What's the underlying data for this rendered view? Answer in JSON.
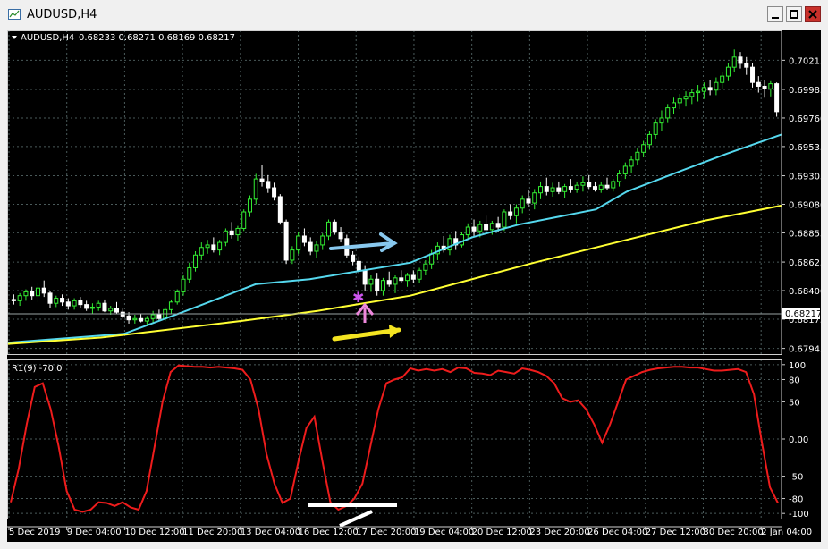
{
  "window": {
    "title": "AUDUSD,H4",
    "buttons": [
      "minimize",
      "maximize",
      "close"
    ]
  },
  "chart_data": [
    {
      "type": "candlestick",
      "header_symbol": "AUDUSD,H4",
      "header_ohlc": "0.68233 0.68271 0.68169 0.68217",
      "y_ticks": [
        "0.70215",
        "0.69985",
        "0.69760",
        "0.69535",
        "0.69305",
        "0.69080",
        "0.68855",
        "0.68625",
        "0.68400",
        "0.68175",
        "0.67945"
      ],
      "current_price": "0.68217",
      "ylim": [
        0.679,
        0.7045
      ],
      "colors": {
        "bull": "#33ee33",
        "bear": "#ffffff",
        "ma_fast": "#55d8ee",
        "ma_slow": "#ffff33",
        "background": "#000000",
        "grid": "#4a5a5a"
      },
      "candles": [
        [
          0.6833,
          0.6837,
          0.6829,
          0.6832
        ],
        [
          0.6832,
          0.6838,
          0.6828,
          0.6836
        ],
        [
          0.6836,
          0.6841,
          0.6832,
          0.6839
        ],
        [
          0.6839,
          0.6843,
          0.6833,
          0.6836
        ],
        [
          0.6836,
          0.6846,
          0.6831,
          0.6842
        ],
        [
          0.6842,
          0.6848,
          0.6835,
          0.6838
        ],
        [
          0.6838,
          0.684,
          0.6826,
          0.683
        ],
        [
          0.683,
          0.6836,
          0.6827,
          0.6834
        ],
        [
          0.6834,
          0.6837,
          0.6828,
          0.6831
        ],
        [
          0.6831,
          0.6834,
          0.6825,
          0.6828
        ],
        [
          0.6828,
          0.6834,
          0.6825,
          0.6832
        ],
        [
          0.6832,
          0.6835,
          0.6826,
          0.6829
        ],
        [
          0.6829,
          0.6832,
          0.6824,
          0.6826
        ],
        [
          0.6826,
          0.683,
          0.6822,
          0.6827
        ],
        [
          0.6827,
          0.6832,
          0.6824,
          0.683
        ],
        [
          0.683,
          0.6833,
          0.6823,
          0.6824
        ],
        [
          0.6824,
          0.6828,
          0.6821,
          0.6826
        ],
        [
          0.6826,
          0.6831,
          0.6822,
          0.6823
        ],
        [
          0.6823,
          0.6826,
          0.6818,
          0.682
        ],
        [
          0.682,
          0.6823,
          0.6814,
          0.6817
        ],
        [
          0.6817,
          0.6821,
          0.6814,
          0.6818
        ],
        [
          0.6818,
          0.6822,
          0.6815,
          0.6816
        ],
        [
          0.6816,
          0.682,
          0.6813,
          0.6818
        ],
        [
          0.6818,
          0.6824,
          0.6815,
          0.6821
        ],
        [
          0.6821,
          0.6825,
          0.6816,
          0.6818
        ],
        [
          0.6818,
          0.6827,
          0.6816,
          0.6825
        ],
        [
          0.6825,
          0.6833,
          0.6822,
          0.6831
        ],
        [
          0.6831,
          0.6841,
          0.6829,
          0.6839
        ],
        [
          0.6839,
          0.6852,
          0.6836,
          0.6849
        ],
        [
          0.6849,
          0.6862,
          0.6846,
          0.6858
        ],
        [
          0.6858,
          0.6871,
          0.6855,
          0.6868
        ],
        [
          0.6868,
          0.6878,
          0.6864,
          0.6874
        ],
        [
          0.6874,
          0.688,
          0.6869,
          0.6876
        ],
        [
          0.6876,
          0.6882,
          0.687,
          0.6872
        ],
        [
          0.6872,
          0.688,
          0.6868,
          0.6878
        ],
        [
          0.6878,
          0.6889,
          0.6875,
          0.6887
        ],
        [
          0.6887,
          0.6894,
          0.6881,
          0.6884
        ],
        [
          0.6884,
          0.6891,
          0.6879,
          0.6889
        ],
        [
          0.6889,
          0.6904,
          0.6887,
          0.6902
        ],
        [
          0.6902,
          0.6915,
          0.6898,
          0.6912
        ],
        [
          0.6912,
          0.6932,
          0.6908,
          0.6928
        ],
        [
          0.6928,
          0.6939,
          0.6922,
          0.6926
        ],
        [
          0.6926,
          0.6931,
          0.6917,
          0.6921
        ],
        [
          0.6921,
          0.6925,
          0.6911,
          0.6914
        ],
        [
          0.6914,
          0.6916,
          0.6892,
          0.6894
        ],
        [
          0.6894,
          0.6896,
          0.6861,
          0.6864
        ],
        [
          0.6864,
          0.6875,
          0.6861,
          0.6872
        ],
        [
          0.6872,
          0.6886,
          0.6869,
          0.6883
        ],
        [
          0.6883,
          0.6889,
          0.6875,
          0.6878
        ],
        [
          0.6878,
          0.6882,
          0.6868,
          0.6871
        ],
        [
          0.6871,
          0.6879,
          0.6866,
          0.6876
        ],
        [
          0.6876,
          0.6885,
          0.6872,
          0.6883
        ],
        [
          0.6883,
          0.6896,
          0.688,
          0.6894
        ],
        [
          0.6894,
          0.6896,
          0.6884,
          0.6886
        ],
        [
          0.6886,
          0.689,
          0.6878,
          0.6881
        ],
        [
          0.6881,
          0.6884,
          0.6866,
          0.6868
        ],
        [
          0.6868,
          0.6871,
          0.686,
          0.6863
        ],
        [
          0.6863,
          0.6867,
          0.6853,
          0.6856
        ],
        [
          0.6856,
          0.686,
          0.684,
          0.6845
        ],
        [
          0.6845,
          0.6852,
          0.6839,
          0.6849
        ],
        [
          0.6849,
          0.6854,
          0.6836,
          0.684
        ],
        [
          0.684,
          0.685,
          0.6836,
          0.6848
        ],
        [
          0.6848,
          0.6855,
          0.6843,
          0.6845
        ],
        [
          0.6845,
          0.6852,
          0.6838,
          0.685
        ],
        [
          0.685,
          0.6856,
          0.6846,
          0.6848
        ],
        [
          0.6848,
          0.6854,
          0.6843,
          0.6852
        ],
        [
          0.6852,
          0.6856,
          0.6846,
          0.6849
        ],
        [
          0.6849,
          0.6858,
          0.6846,
          0.6856
        ],
        [
          0.6856,
          0.6864,
          0.6852,
          0.6861
        ],
        [
          0.6861,
          0.6872,
          0.6857,
          0.6869
        ],
        [
          0.6869,
          0.6878,
          0.6864,
          0.6875
        ],
        [
          0.6875,
          0.6883,
          0.687,
          0.6872
        ],
        [
          0.6872,
          0.6884,
          0.6868,
          0.6881
        ],
        [
          0.6881,
          0.6887,
          0.6872,
          0.6876
        ],
        [
          0.6876,
          0.6886,
          0.6874,
          0.6884
        ],
        [
          0.6884,
          0.6893,
          0.688,
          0.689
        ],
        [
          0.689,
          0.6896,
          0.6883,
          0.6887
        ],
        [
          0.6887,
          0.6895,
          0.6882,
          0.6892
        ],
        [
          0.6892,
          0.6899,
          0.6885,
          0.6888
        ],
        [
          0.6888,
          0.6895,
          0.6884,
          0.6893
        ],
        [
          0.6893,
          0.6898,
          0.6886,
          0.689
        ],
        [
          0.689,
          0.6904,
          0.6887,
          0.6902
        ],
        [
          0.6902,
          0.6908,
          0.6896,
          0.6899
        ],
        [
          0.6899,
          0.6908,
          0.6893,
          0.6905
        ],
        [
          0.6905,
          0.6915,
          0.6901,
          0.6912
        ],
        [
          0.6912,
          0.6919,
          0.6906,
          0.6909
        ],
        [
          0.6909,
          0.692,
          0.6904,
          0.6917
        ],
        [
          0.6917,
          0.6926,
          0.6912,
          0.6922
        ],
        [
          0.6922,
          0.6929,
          0.6915,
          0.6918
        ],
        [
          0.6918,
          0.6925,
          0.6914,
          0.6921
        ],
        [
          0.6921,
          0.6926,
          0.6916,
          0.6918
        ],
        [
          0.6918,
          0.6924,
          0.6913,
          0.6922
        ],
        [
          0.6922,
          0.6928,
          0.6917,
          0.692
        ],
        [
          0.692,
          0.6926,
          0.6917,
          0.6923
        ],
        [
          0.6923,
          0.693,
          0.6918,
          0.6925
        ],
        [
          0.6925,
          0.6931,
          0.692,
          0.6922
        ],
        [
          0.6922,
          0.6926,
          0.6918,
          0.692
        ],
        [
          0.692,
          0.6926,
          0.6917,
          0.6923
        ],
        [
          0.6923,
          0.6929,
          0.6919,
          0.6921
        ],
        [
          0.6921,
          0.6928,
          0.6918,
          0.6926
        ],
        [
          0.6926,
          0.6935,
          0.6922,
          0.6932
        ],
        [
          0.6932,
          0.6941,
          0.6928,
          0.6938
        ],
        [
          0.6938,
          0.6946,
          0.6933,
          0.6943
        ],
        [
          0.6943,
          0.6952,
          0.6939,
          0.6949
        ],
        [
          0.6949,
          0.6958,
          0.6945,
          0.6955
        ],
        [
          0.6955,
          0.6966,
          0.6951,
          0.6963
        ],
        [
          0.6963,
          0.6975,
          0.6959,
          0.6972
        ],
        [
          0.6972,
          0.6982,
          0.6966,
          0.6976
        ],
        [
          0.6976,
          0.6987,
          0.6972,
          0.6984
        ],
        [
          0.6984,
          0.6992,
          0.6979,
          0.6988
        ],
        [
          0.6988,
          0.6995,
          0.6983,
          0.6991
        ],
        [
          0.6991,
          0.6997,
          0.6985,
          0.6993
        ],
        [
          0.6993,
          0.6999,
          0.6987,
          0.6996
        ],
        [
          0.6996,
          0.7002,
          0.6989,
          0.6997
        ],
        [
          0.6997,
          0.7004,
          0.6991,
          0.7
        ],
        [
          0.7,
          0.7006,
          0.6994,
          0.6998
        ],
        [
          0.6998,
          0.7008,
          0.6994,
          0.7004
        ],
        [
          0.7004,
          0.7012,
          0.6999,
          0.7009
        ],
        [
          0.7009,
          0.7019,
          0.7005,
          0.7016
        ],
        [
          0.7016,
          0.703,
          0.7012,
          0.7024
        ],
        [
          0.7024,
          0.7028,
          0.7015,
          0.7019
        ],
        [
          0.7019,
          0.7024,
          0.701,
          0.7016
        ],
        [
          0.7016,
          0.7019,
          0.7,
          0.7004
        ],
        [
          0.7004,
          0.7009,
          0.6996,
          0.7001
        ],
        [
          0.7001,
          0.7006,
          0.6992,
          0.6999
        ],
        [
          0.6999,
          0.7005,
          0.6993,
          0.7003
        ],
        [
          0.7003,
          0.7004,
          0.6977,
          0.6981
        ]
      ],
      "ma_fast": [
        [
          0,
          0.6799
        ],
        [
          0.15,
          0.6806
        ],
        [
          0.23,
          0.6824
        ],
        [
          0.32,
          0.6845
        ],
        [
          0.39,
          0.6849
        ],
        [
          0.52,
          0.6862
        ],
        [
          0.6,
          0.6882
        ],
        [
          0.66,
          0.6892
        ],
        [
          0.76,
          0.6904
        ],
        [
          0.8,
          0.6918
        ],
        [
          0.86,
          0.6932
        ],
        [
          0.93,
          0.6948
        ],
        [
          1,
          0.6963
        ]
      ],
      "ma_slow": [
        [
          0,
          0.6798
        ],
        [
          0.12,
          0.6803
        ],
        [
          0.3,
          0.6816
        ],
        [
          0.4,
          0.6824
        ],
        [
          0.52,
          0.6836
        ],
        [
          0.68,
          0.6862
        ],
        [
          0.8,
          0.688
        ],
        [
          0.9,
          0.6895
        ],
        [
          1,
          0.6907
        ]
      ]
    },
    {
      "type": "line",
      "header": "R1(9) -70.0",
      "y_ticks": [
        "100",
        "80",
        "50",
        "0.00",
        "-50",
        "-80",
        "-100"
      ],
      "ylim": [
        -107,
        107
      ],
      "colors": {
        "line": "#ee1c1c"
      },
      "values": [
        -85,
        -40,
        20,
        70,
        75,
        40,
        -10,
        -70,
        -95,
        -98,
        -95,
        -85,
        -86,
        -90,
        -85,
        -92,
        -95,
        -70,
        -10,
        50,
        90,
        99,
        98,
        97,
        97,
        96,
        97,
        96,
        95,
        93,
        80,
        40,
        -20,
        -60,
        -86,
        -80,
        -30,
        15,
        30,
        -30,
        -85,
        -95,
        -90,
        -80,
        -60,
        -10,
        40,
        75,
        80,
        83,
        95,
        92,
        94,
        92,
        94,
        90,
        96,
        95,
        89,
        88,
        86,
        92,
        90,
        88,
        95,
        93,
        90,
        85,
        75,
        55,
        50,
        52,
        40,
        20,
        -5,
        20,
        50,
        80,
        85,
        90,
        93,
        95,
        96,
        97,
        97,
        96,
        96,
        94,
        92,
        92,
        93,
        94,
        90,
        60,
        -5,
        -65,
        -86
      ]
    }
  ],
  "x_axis": {
    "tick_labels": [
      "5 Dec 2019",
      "9 Dec 04:00",
      "10 Dec 12:00",
      "11 Dec 20:00",
      "13 Dec 04:00",
      "16 Dec 12:00",
      "17 Dec 20:00",
      "19 Dec 04:00",
      "20 Dec 12:00",
      "23 Dec 20:00",
      "26 Dec 04:00",
      "27 Dec 12:00",
      "30 Dec 20:00",
      "2 Jan 04:00"
    ]
  },
  "annotations": {
    "light_blue_arrow": "#88c8ee",
    "yellow_arrow": "#f4e421",
    "pink_arrow": "#ee88dd",
    "purple_star": "#cc55ee",
    "white_lines": "#ffffff"
  }
}
